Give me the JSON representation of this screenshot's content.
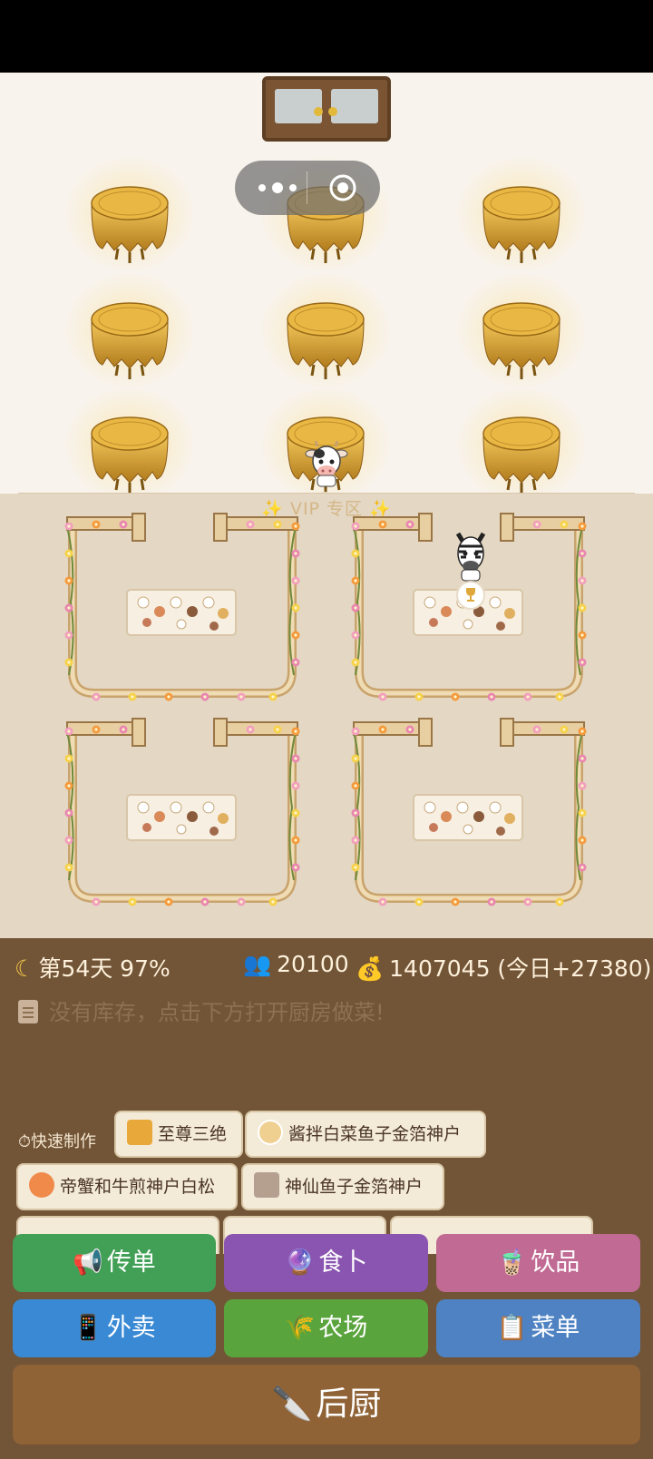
{
  "vip_title": "✨ VIP 专区 ✨",
  "stats": {
    "moon_icon": "crescent-moon-icon",
    "day_text": "第54天 97%",
    "guests_icon": "people-icon",
    "guests": "20100",
    "money_icon": "money-bag-icon",
    "money": "1407045 (今日+27380)"
  },
  "stock_message": "没有库存，点击下方打开厨房做菜!",
  "quick_make": {
    "label": "⏱快速制作",
    "items": [
      {
        "label": "至尊三绝",
        "icon": "trophy-icon"
      },
      {
        "label": "酱拌白菜鱼子金箔神户",
        "icon": "dish-icon"
      },
      {
        "label": "帝蟹和牛煎神户白松",
        "icon": "shrimp-icon"
      },
      {
        "label": "神仙鱼子金箔神户",
        "icon": "skewer-icon"
      }
    ]
  },
  "buttons": {
    "flyer": {
      "label": "传单",
      "icon": "megaphone-icon",
      "glyph": "📢"
    },
    "fortune": {
      "label": "食卜",
      "icon": "crystal-ball-icon",
      "glyph": "🔮"
    },
    "drinks": {
      "label": "饮品",
      "icon": "bubble-tea-icon",
      "glyph": "🧋"
    },
    "delivery": {
      "label": "外卖",
      "icon": "phone-icon",
      "glyph": "📱"
    },
    "farm": {
      "label": "农场",
      "icon": "wheat-icon",
      "glyph": "🌾"
    },
    "menu": {
      "label": "菜单",
      "icon": "clipboard-icon",
      "glyph": "📋"
    },
    "kitchen": {
      "label": "后厨",
      "icon": "knife-icon",
      "glyph": "🔪"
    }
  },
  "colors": {
    "hall_floor": "#f8f3ec",
    "vip_floor": "#e4d7c3",
    "panel": "#725436",
    "gold_table": "#d9a83a"
  }
}
